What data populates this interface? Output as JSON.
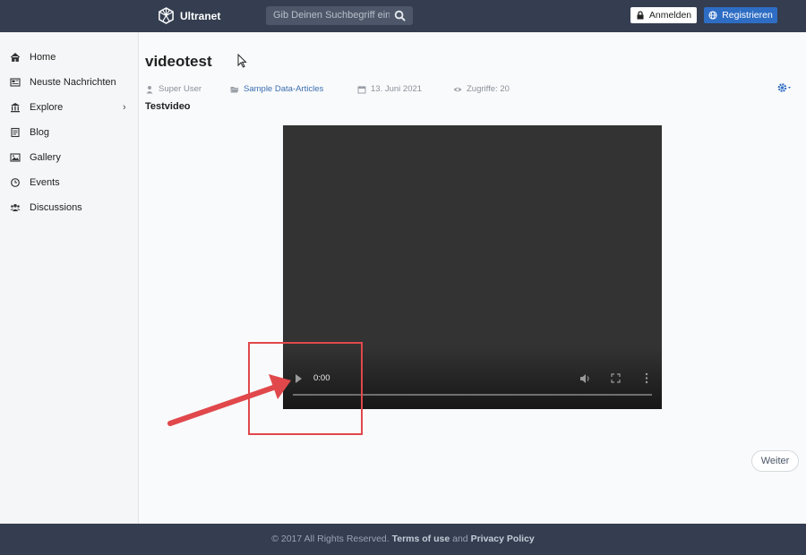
{
  "header": {
    "brand": "Ultranet",
    "search_placeholder": "Gib Deinen Suchbegriff ein",
    "login_label": "Anmelden",
    "register_label": "Registrieren"
  },
  "sidebar": {
    "items": [
      {
        "label": "Home",
        "icon": "home-icon"
      },
      {
        "label": "Neuste Nachrichten",
        "icon": "newspaper-icon"
      },
      {
        "label": "Explore",
        "icon": "bank-icon"
      },
      {
        "label": "Blog",
        "icon": "blog-icon"
      },
      {
        "label": "Gallery",
        "icon": "image-icon"
      },
      {
        "label": "Events",
        "icon": "clock-icon"
      },
      {
        "label": "Discussions",
        "icon": "users-icon"
      }
    ]
  },
  "article": {
    "title": "videotest",
    "author": "Super User",
    "category": "Sample Data-Articles",
    "date": "13. Juni 2021",
    "hits": "Zugriffe: 20",
    "subtitle": "Testvideo"
  },
  "video": {
    "time": "0:00"
  },
  "pagination": {
    "next_label": "Weiter"
  },
  "footer": {
    "copyright": "© 2017 All Rights Reserved.",
    "terms": "Terms of use",
    "and": "and",
    "privacy": "Privacy Policy"
  },
  "colors": {
    "header_bg": "#343e50",
    "accent": "#2e6dc4",
    "annotation": "#e0484b"
  }
}
